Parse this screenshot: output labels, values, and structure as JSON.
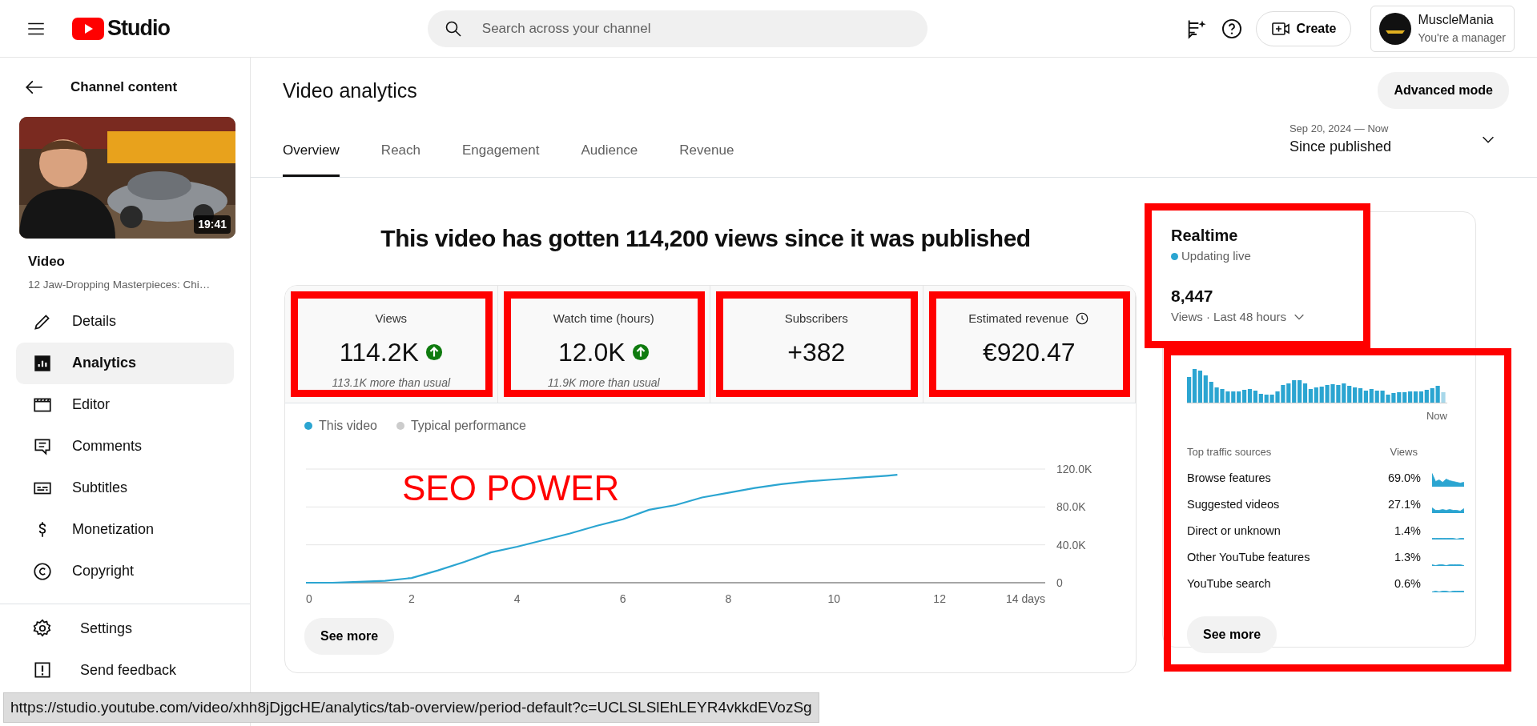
{
  "topbar": {
    "logo_text": "Studio",
    "search": {
      "placeholder": "Search across your channel"
    },
    "create_label": "Create",
    "account": {
      "name": "MuscleMania",
      "role": "You're a manager"
    }
  },
  "sidebar": {
    "back_label": "Channel content",
    "video": {
      "duration": "19:41",
      "heading": "Video",
      "title": "12 Jaw-Dropping Masterpieces: Chi…"
    },
    "items": [
      {
        "label": "Details",
        "selected": false
      },
      {
        "label": "Analytics",
        "selected": true
      },
      {
        "label": "Editor",
        "selected": false
      },
      {
        "label": "Comments",
        "selected": false
      },
      {
        "label": "Subtitles",
        "selected": false
      },
      {
        "label": "Monetization",
        "selected": false
      },
      {
        "label": "Copyright",
        "selected": false
      }
    ],
    "footer_items": [
      {
        "label": "Settings"
      },
      {
        "label": "Send feedback"
      }
    ]
  },
  "page": {
    "title": "Video analytics",
    "advanced_button": "Advanced mode",
    "tabs": [
      {
        "label": "Overview",
        "selected": true
      },
      {
        "label": "Reach",
        "selected": false
      },
      {
        "label": "Engagement",
        "selected": false
      },
      {
        "label": "Audience",
        "selected": false
      },
      {
        "label": "Revenue",
        "selected": false
      }
    ],
    "period": {
      "range": "Sep 20, 2024 — Now",
      "label": "Since published"
    }
  },
  "headline": "This video has gotten 114,200 views since it was published",
  "metrics": [
    {
      "label": "Views",
      "value": "114.2K",
      "rising": true,
      "note": "113.1K more than usual",
      "highlighted": true
    },
    {
      "label": "Watch time (hours)",
      "value": "12.0K",
      "rising": true,
      "note": "11.9K more than usual",
      "highlighted": true
    },
    {
      "label": "Subscribers",
      "value": "+382",
      "highlighted": true
    },
    {
      "label": "Estimated revenue",
      "value": "€920.47",
      "clock_icon": true,
      "highlighted": true
    }
  ],
  "chart": {
    "annotation_text": "SEO POWER",
    "chart_data": {
      "type": "line",
      "x": [
        0,
        0.5,
        1,
        1.5,
        2,
        2.5,
        3,
        3.5,
        4,
        4.5,
        5,
        5.5,
        6,
        6.5,
        7,
        7.5,
        8,
        8.5,
        9,
        9.5,
        10,
        10.5,
        11,
        11.2
      ],
      "series": [
        {
          "name": "This video",
          "color": "#2ba5d1",
          "values": [
            0,
            0,
            1000,
            2000,
            5000,
            13000,
            22000,
            32000,
            38000,
            45000,
            52000,
            60000,
            67000,
            77000,
            82000,
            90000,
            95000,
            100000,
            104000,
            107000,
            109000,
            111000,
            113000,
            114000
          ]
        },
        {
          "name": "Typical performance",
          "color": "#cccccc",
          "values": [
            null,
            null,
            null,
            null,
            null,
            null,
            null,
            null,
            null,
            null,
            null,
            null,
            null,
            null,
            null,
            null,
            null,
            null,
            null,
            null,
            null,
            null,
            null,
            null
          ]
        }
      ],
      "xlim": [
        0,
        14
      ],
      "ylim": [
        0,
        120000
      ],
      "xticks": [
        0,
        2,
        4,
        6,
        8,
        10,
        12,
        {
          "value": 14,
          "label": "14 days"
        }
      ],
      "yticks": [
        0,
        {
          "value": 40000,
          "label": "40.0K"
        },
        {
          "value": 80000,
          "label": "80.0K"
        },
        {
          "value": 120000,
          "label": "120.0K"
        }
      ]
    },
    "see_more": "See more"
  },
  "realtime": {
    "title": "Realtime",
    "status": "Updating live",
    "count": "8,447",
    "period": "Views · Last 48 hours",
    "highlighted": true,
    "bars_end_label": "Now",
    "traffic": {
      "highlighted": true,
      "heading": "Top traffic sources",
      "views_heading": "Views",
      "rows": [
        {
          "source": "Browse features",
          "share": "69.0%"
        },
        {
          "source": "Suggested videos",
          "share": "27.1%"
        },
        {
          "source": "Direct or unknown",
          "share": "1.4%"
        },
        {
          "source": "Other YouTube features",
          "share": "1.3%"
        },
        {
          "source": "YouTube search",
          "share": "0.6%"
        }
      ],
      "see_more": "See more"
    }
  },
  "status_bar": "https://studio.youtube.com/video/xhh8jDjgcHE/analytics/tab-overview/period-default?c=UCLSLSlEhLEYR4vkkdEVozSg"
}
